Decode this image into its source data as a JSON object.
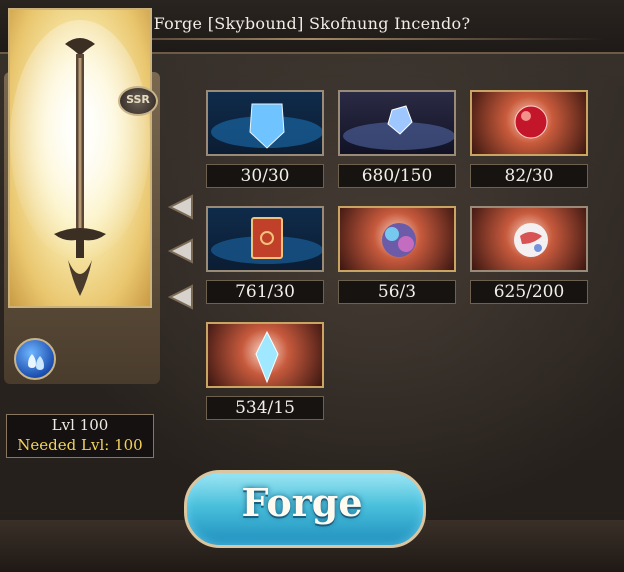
{
  "dialog": {
    "title": "Forge [Skybound] Skofnung Incendo?"
  },
  "weapon": {
    "rarity_badge": "SSR",
    "element_icon": "water-element-icon",
    "level_text": "Lvl 100",
    "needed_level_text": "Needed Lvl: 100"
  },
  "materials": [
    {
      "name": "blue-crystal-shield",
      "count": "30/30"
    },
    {
      "name": "blue-gem-crystal",
      "count": "680/150"
    },
    {
      "name": "red-orb",
      "count": "82/30"
    },
    {
      "name": "red-book",
      "count": "761/30"
    },
    {
      "name": "rainbow-orb",
      "count": "56/3"
    },
    {
      "name": "red-marble-orb",
      "count": "625/200"
    },
    {
      "name": "light-blue-crystal",
      "count": "534/15"
    }
  ],
  "actions": {
    "forge_label": "Forge"
  },
  "colors": {
    "button_primary": "#4ac0dc",
    "needed_level_text": "#f2d35a",
    "gold_frame": "#c9a463"
  }
}
